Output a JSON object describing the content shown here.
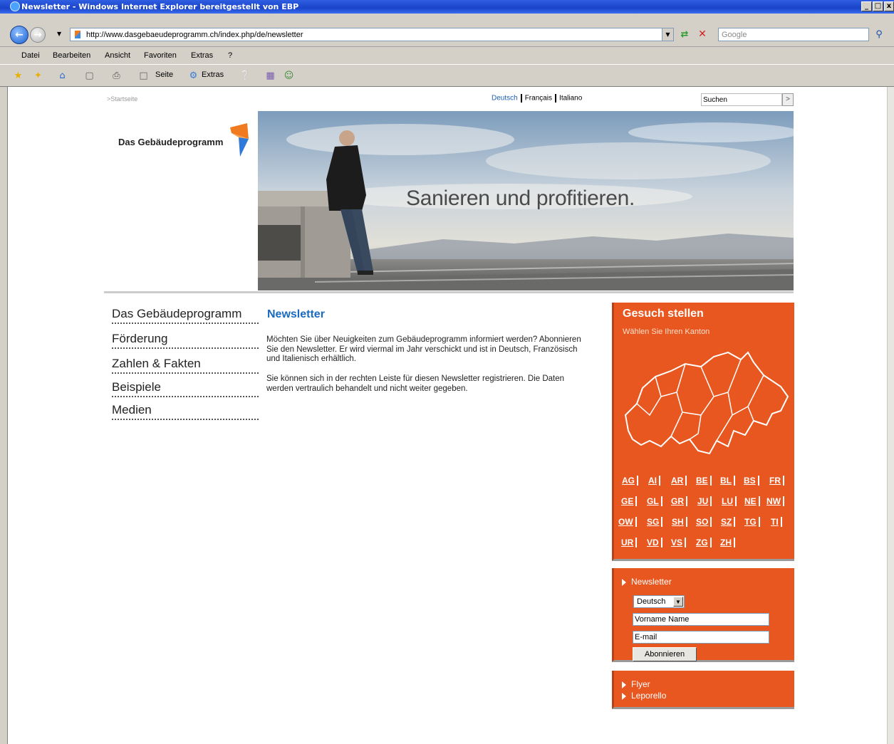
{
  "window": {
    "title": "Newsletter - Windows Internet Explorer bereitgestellt von EBP",
    "btn_min": "_",
    "btn_max": "□",
    "btn_close": "x"
  },
  "address_bar": {
    "url": "http://www.dasgebaeudeprogramm.ch/index.php/de/newsletter",
    "search_placeholder": "Google"
  },
  "menu": [
    "Datei",
    "Bearbeiten",
    "Ansicht",
    "Favoriten",
    "Extras",
    "?"
  ],
  "toolbar": {
    "page_label": "Seite",
    "extras_label": "Extras"
  },
  "page": {
    "breadcrumb": ">Startseite",
    "languages": [
      "Deutsch",
      "Français",
      "Italiano"
    ],
    "search_value": "Suchen",
    "search_button": ">",
    "logo_text": "Das Gebäudeprogramm",
    "hero_headline": "Sanieren und profitieren.",
    "nav": [
      "Das Gebäudeprogramm",
      "Förderung",
      "Zahlen & Fakten",
      "Beispiele",
      "Medien"
    ],
    "content": {
      "title": "Newsletter",
      "para1": "Möchten Sie über Neuigkeiten zum Gebäudeprogramm informiert werden? Abonnieren Sie den Newsletter. Er wird viermal im Jahr verschickt und ist in Deutsch, Französisch und Italienisch erhältlich.",
      "para2": "Sie können sich in der rechten Leiste für diesen Newsletter registrieren. Die Daten werden vertraulich behandelt und nicht weiter gegeben."
    },
    "gesuch": {
      "title": "Gesuch stellen",
      "subtitle": "Wählen Sie Ihren Kanton",
      "kantone": [
        "AG",
        "AI",
        "AR",
        "BE",
        "BL",
        "BS",
        "FR",
        "GE",
        "GL",
        "GR",
        "JU",
        "LU",
        "NE",
        "NW",
        "OW",
        "SG",
        "SH",
        "SO",
        "SZ",
        "TG",
        "TI",
        "UR",
        "VD",
        "VS",
        "ZG",
        "ZH"
      ]
    },
    "newsletter_box": {
      "title": "Newsletter",
      "language_selected": "Deutsch",
      "name_value": "Vorname Name",
      "email_value": "E-mail",
      "button": "Abonnieren"
    },
    "links_box": [
      "Flyer",
      "Leporello"
    ],
    "colors": {
      "accent_orange": "#e8571f",
      "link_blue": "#1a6bbf"
    }
  }
}
